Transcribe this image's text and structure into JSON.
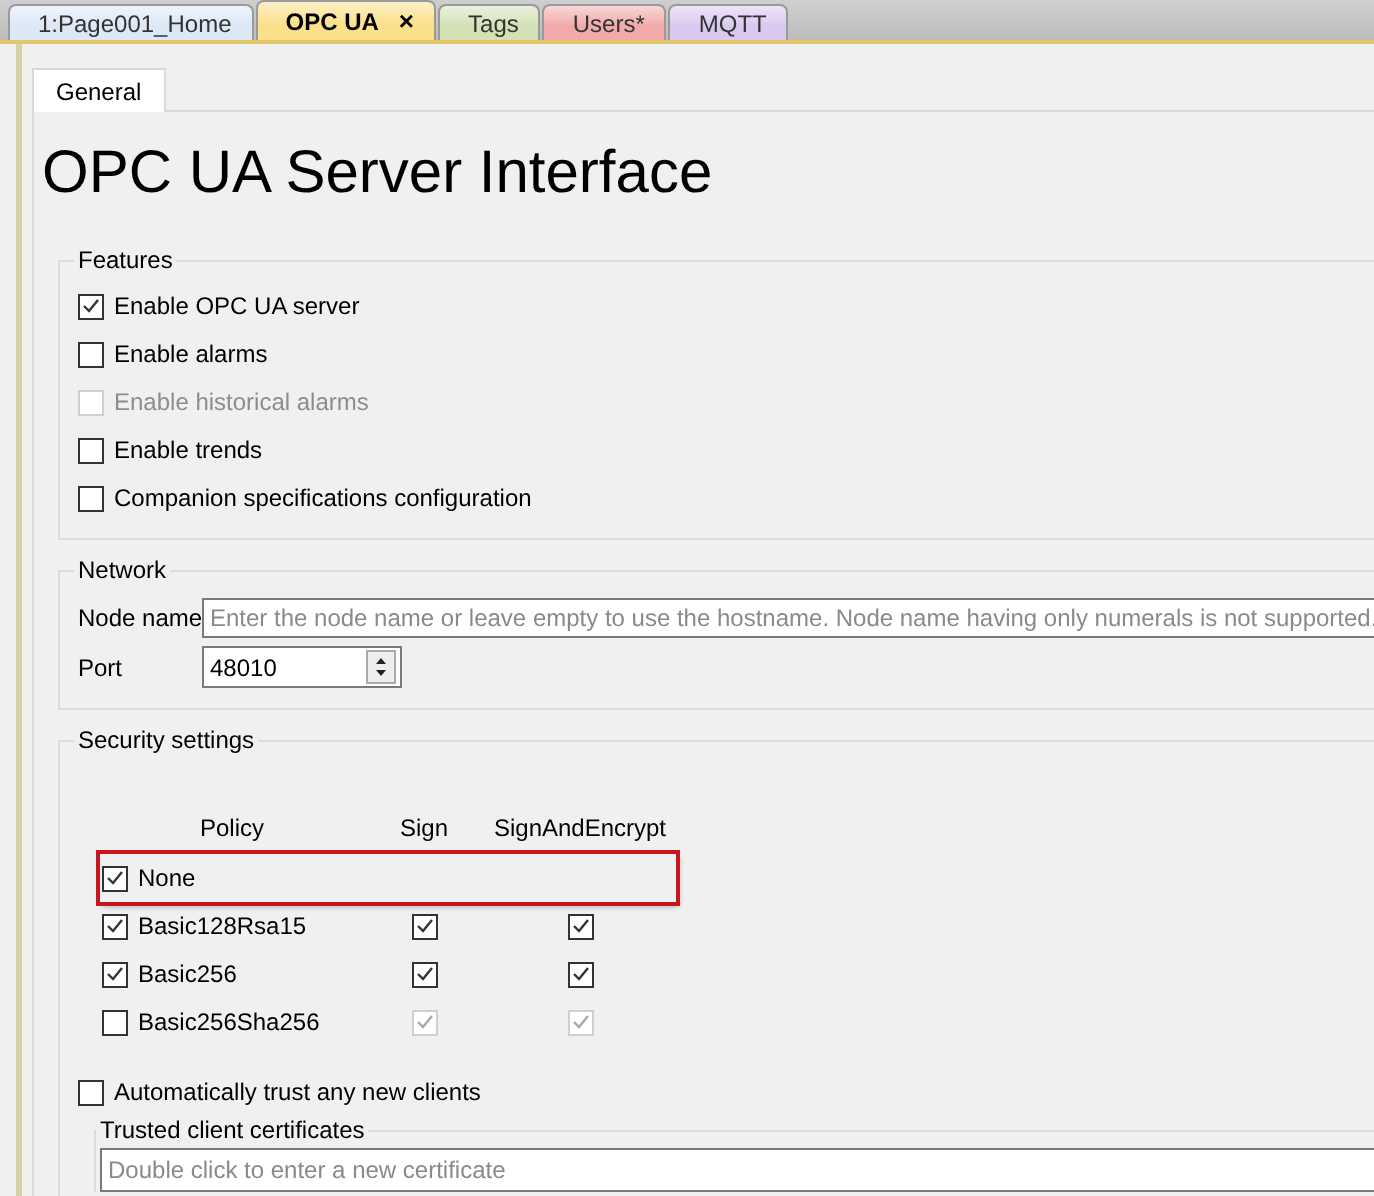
{
  "document_tabs": [
    {
      "label": "1:Page001_Home",
      "selected": false,
      "color": "#dce8f6",
      "closable": false
    },
    {
      "label": "OPC UA",
      "selected": true,
      "color": "#fbe08a",
      "closable": true,
      "close": "×"
    },
    {
      "label": "Tags",
      "selected": false,
      "color": "#d3e2b6",
      "closable": false
    },
    {
      "label": "Users*",
      "selected": false,
      "color": "#f2a9a9",
      "closable": false
    },
    {
      "label": "MQTT",
      "selected": false,
      "color": "#d9c9ee",
      "closable": false
    }
  ],
  "page_tabs": [
    {
      "label": "General",
      "selected": true
    }
  ],
  "title": "OPC UA Server Interface",
  "features": {
    "legend": "Features",
    "options": [
      {
        "label": "Enable OPC UA server",
        "checked": true,
        "disabled": false
      },
      {
        "label": "Enable alarms",
        "checked": false,
        "disabled": false
      },
      {
        "label": "Enable historical alarms",
        "checked": false,
        "disabled": true
      },
      {
        "label": "Enable trends",
        "checked": false,
        "disabled": false
      },
      {
        "label": "Companion specifications configuration",
        "checked": false,
        "disabled": false
      }
    ]
  },
  "network": {
    "legend": "Network",
    "node_name": {
      "label": "Node name",
      "placeholder": "Enter the node name or leave empty to use the hostname. Node name having only numerals is not supported."
    },
    "port": {
      "label": "Port",
      "value": "48010"
    }
  },
  "security": {
    "legend": "Security settings",
    "columns": [
      "Policy",
      "Sign",
      "SignAndEncrypt"
    ],
    "policies": [
      {
        "name": "None",
        "checked": true,
        "highlighted": true
      },
      {
        "name": "Basic128Rsa15",
        "checked": true,
        "highlighted": false,
        "sign": {
          "checked": true,
          "disabled": false
        },
        "sign_and_encrypt": {
          "checked": true,
          "disabled": false
        }
      },
      {
        "name": "Basic256",
        "checked": true,
        "highlighted": false,
        "sign": {
          "checked": true,
          "disabled": false
        },
        "sign_and_encrypt": {
          "checked": true,
          "disabled": false
        }
      },
      {
        "name": "Basic256Sha256",
        "checked": false,
        "highlighted": false,
        "sign": {
          "checked": true,
          "disabled": true
        },
        "sign_and_encrypt": {
          "checked": true,
          "disabled": true
        }
      }
    ],
    "auto_trust": {
      "label": "Automatically trust any new clients",
      "checked": false
    },
    "trusted": {
      "legend": "Trusted client certificates",
      "placeholder": "Double click to enter a new certificate"
    }
  }
}
